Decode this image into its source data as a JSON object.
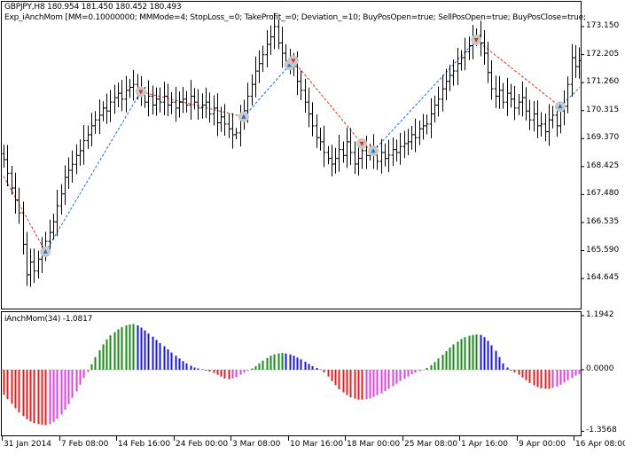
{
  "chart_data": [
    {
      "type": "ohlc",
      "title": "GBPJPY,H8  180.954 181.450 180.452 180.493",
      "expert_label": "Exp_iAnchMom [MM=0.10000000; MMMode=4; StopLoss_=0; TakeProfit_=0; Deviation_=10; BuyPosOpen=true; SellPosOpen=true; BuyPosClose=true;",
      "ylim": [
        164.2,
        174.0
      ],
      "y_ticks": [
        "173.150",
        "172.205",
        "171.260",
        "170.315",
        "169.370",
        "168.425",
        "167.480",
        "166.535",
        "165.590",
        "164.645"
      ],
      "close": [
        168.66,
        168.2,
        167.7,
        167.3,
        166.86,
        165.8,
        164.77,
        165.2,
        164.9,
        165.3,
        165.52,
        165.9,
        166.2,
        166.56,
        167.1,
        167.5,
        168.06,
        168.3,
        168.5,
        168.8,
        168.96,
        169.3,
        169.5,
        169.8,
        170.0,
        170.16,
        170.4,
        170.3,
        170.6,
        170.75,
        170.9,
        170.7,
        171.0,
        171.1,
        171.2,
        171.0,
        170.9,
        170.6,
        170.8,
        170.5,
        170.7,
        170.6,
        170.8,
        170.5,
        170.6,
        170.4,
        170.6,
        170.7,
        170.5,
        170.8,
        170.6,
        170.4,
        170.5,
        170.6,
        170.2,
        170.4,
        169.9,
        170.1,
        169.86,
        169.7,
        169.5,
        169.56,
        170.0,
        170.31,
        170.8,
        171.2,
        171.65,
        171.9,
        172.2,
        172.55,
        172.8,
        173.15,
        172.6,
        172.25,
        172.0,
        171.9,
        171.8,
        171.3,
        171.0,
        170.6,
        170.2,
        169.8,
        169.4,
        169.26,
        168.9,
        168.7,
        168.51,
        168.7,
        169.0,
        168.8,
        169.26,
        168.9,
        168.51,
        168.7,
        168.96,
        168.8,
        169.0,
        168.81,
        168.6,
        168.9,
        168.7,
        168.81,
        169.0,
        168.9,
        169.1,
        169.2,
        169.26,
        169.5,
        169.4,
        169.7,
        169.8,
        169.86,
        170.2,
        170.5,
        170.7,
        171.05,
        171.3,
        171.5,
        171.65,
        171.9,
        172.1,
        172.3,
        172.5,
        172.7,
        172.85,
        172.6,
        172.25,
        171.6,
        171.05,
        170.8,
        171.0,
        170.6,
        170.9,
        170.7,
        170.4,
        170.6,
        170.75,
        170.3,
        170.0,
        170.2,
        169.8,
        169.86,
        169.6,
        170.0,
        170.16,
        169.8,
        170.3,
        170.46,
        171.2,
        172.1,
        171.8,
        172.0
      ],
      "signals": [
        {
          "bar": 11,
          "type": "buy",
          "price": 165.55
        },
        {
          "bar": 36,
          "type": "sell",
          "price": 170.95
        },
        {
          "bar": 63,
          "type": "buy",
          "price": 170.1
        },
        {
          "bar": 75,
          "type": "buy",
          "price": 171.85
        },
        {
          "bar": 76,
          "type": "sell",
          "price": 172.0
        },
        {
          "bar": 94,
          "type": "sell",
          "price": 169.2
        },
        {
          "bar": 97,
          "type": "buy",
          "price": 168.95
        },
        {
          "bar": 124,
          "type": "sell",
          "price": 172.7
        },
        {
          "bar": 146,
          "type": "buy",
          "price": 170.45
        }
      ],
      "colors": {
        "bars": "#000000",
        "buy": "#1e6fd0",
        "sell": "#e0301e",
        "buy_line": "#1e6fd0",
        "sell_line": "#e0301e"
      }
    },
    {
      "type": "histogram",
      "title": "iAnchMom(34) -1.0817",
      "ylim": [
        -1.3568,
        1.1942
      ],
      "y_ticks": [
        "1.1942",
        "0.0000",
        "-1.3568"
      ],
      "values": [
        -0.55,
        -0.65,
        -0.75,
        -0.85,
        -0.94,
        -1.02,
        -1.09,
        -1.14,
        -1.18,
        -1.2,
        -1.21,
        -1.22,
        -1.2,
        -1.15,
        -1.08,
        -0.99,
        -0.88,
        -0.76,
        -0.62,
        -0.48,
        -0.33,
        -0.18,
        -0.05,
        0.12,
        0.28,
        0.43,
        0.56,
        0.67,
        0.76,
        0.83,
        0.89,
        0.94,
        0.98,
        1.0,
        1.01,
        0.98,
        0.93,
        0.87,
        0.8,
        0.73,
        0.66,
        0.59,
        0.52,
        0.45,
        0.38,
        0.31,
        0.25,
        0.19,
        0.14,
        0.09,
        0.05,
        0.03,
        0.01,
        -0.02,
        -0.04,
        -0.07,
        -0.11,
        -0.15,
        -0.19,
        -0.21,
        -0.19,
        -0.16,
        -0.11,
        -0.06,
        -0.02,
        0.03,
        0.08,
        0.14,
        0.2,
        0.26,
        0.31,
        0.34,
        0.36,
        0.37,
        0.36,
        0.34,
        0.31,
        0.27,
        0.23,
        0.18,
        0.13,
        0.08,
        0.04,
        0.01,
        -0.06,
        -0.15,
        -0.25,
        -0.34,
        -0.43,
        -0.5,
        -0.56,
        -0.61,
        -0.64,
        -0.66,
        -0.66,
        -0.65,
        -0.63,
        -0.6,
        -0.56,
        -0.52,
        -0.47,
        -0.42,
        -0.36,
        -0.31,
        -0.25,
        -0.2,
        -0.15,
        -0.1,
        -0.06,
        -0.03,
        -0.01,
        0.04,
        0.1,
        0.17,
        0.25,
        0.33,
        0.41,
        0.49,
        0.56,
        0.62,
        0.68,
        0.72,
        0.75,
        0.77,
        0.78,
        0.77,
        0.72,
        0.64,
        0.54,
        0.42,
        0.28,
        0.14,
        0.05,
        -0.02,
        -0.06,
        -0.11,
        -0.17,
        -0.23,
        -0.29,
        -0.34,
        -0.38,
        -0.41,
        -0.42,
        -0.42,
        -0.4,
        -0.37,
        -0.33,
        -0.28,
        -0.23,
        -0.18,
        -0.13,
        -0.09
      ],
      "colors": {
        "pos_rising": "#1a8a1a",
        "pos_falling": "#1a1ad0",
        "neg_falling": "#e02020",
        "neg_rising": "#e040e0"
      }
    }
  ],
  "time_axis": {
    "labels": [
      "31 Jan 2014",
      "7 Feb 08:00",
      "14 Feb 16:00",
      "24 Feb 00:00",
      "3 Mar 08:00",
      "10 Mar 16:00",
      "18 Mar 00:00",
      "25 Mar 08:00",
      "1 Apr 16:00",
      "9 Apr 00:00",
      "16 Apr 08:00"
    ],
    "bars_per_label": 15
  }
}
